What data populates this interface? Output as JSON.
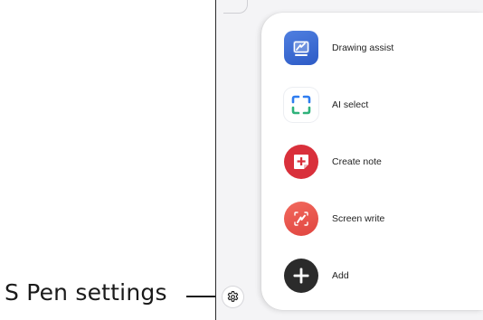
{
  "callout": {
    "label": "S Pen settings"
  },
  "menu": {
    "items": [
      {
        "label": "Drawing assist",
        "icon": "drawing-assist-icon",
        "color": "#3d6fd8"
      },
      {
        "label": "AI select",
        "icon": "ai-select-icon",
        "color": "#2f7df0"
      },
      {
        "label": "Create note",
        "icon": "create-note-icon",
        "color": "#d9303b"
      },
      {
        "label": "Screen write",
        "icon": "screen-write-icon",
        "color": "#ee5a50"
      },
      {
        "label": "Add",
        "icon": "plus-icon",
        "color": "#2b2b2b"
      }
    ]
  },
  "settings": {
    "icon": "gear-icon"
  }
}
